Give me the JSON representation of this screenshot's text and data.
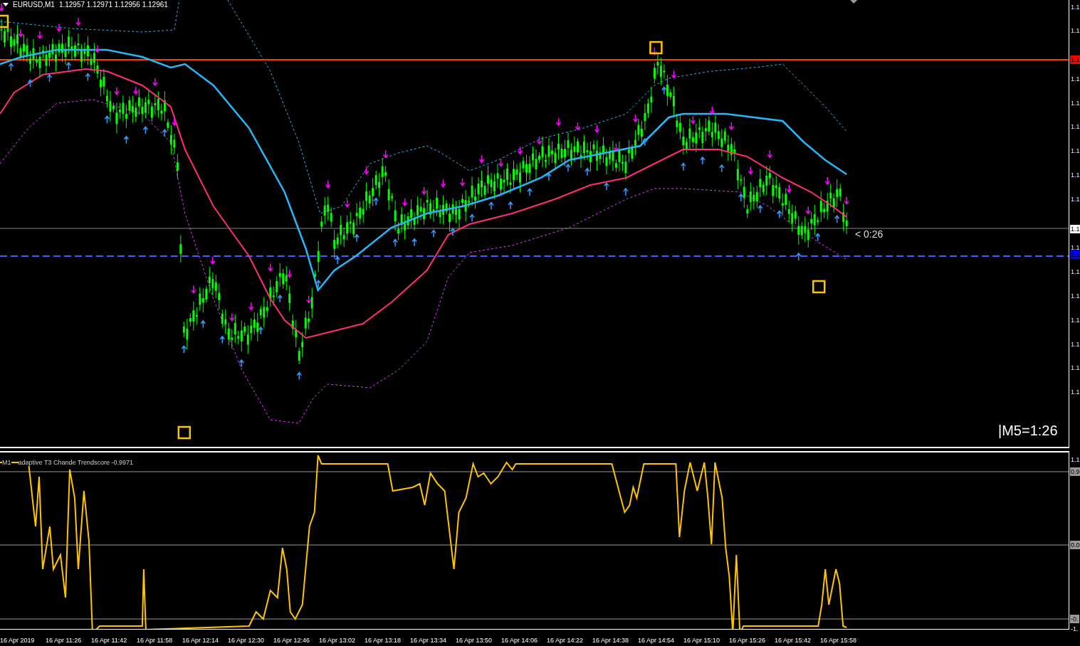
{
  "chart": {
    "symbol": "EURUSD,M1",
    "quotes": "1.12957 1.12971 1.12956 1.12961",
    "countdown": "< 0:26",
    "timeframe_timer": "|M5=1:26"
  },
  "price_axis": [
    {
      "label": "1.1",
      "kind": "plain"
    },
    {
      "label": "1.1",
      "kind": "plain"
    },
    {
      "label": "1.1",
      "kind": "red"
    },
    {
      "label": "1.1",
      "kind": "plain"
    },
    {
      "label": "1.1",
      "kind": "plain"
    },
    {
      "label": "1.1",
      "kind": "plain"
    },
    {
      "label": "1.1",
      "kind": "plain"
    },
    {
      "label": "1.1",
      "kind": "plain"
    },
    {
      "label": "1.1",
      "kind": "plain"
    },
    {
      "label": "1.1",
      "kind": "white"
    },
    {
      "label": "1.1",
      "kind": "plain"
    },
    {
      "label": "1.1",
      "kind": "blue"
    },
    {
      "label": "1.1",
      "kind": "plain"
    },
    {
      "label": "1.1",
      "kind": "plain"
    },
    {
      "label": "1.1",
      "kind": "plain"
    },
    {
      "label": "1.1",
      "kind": "plain"
    },
    {
      "label": "1.1",
      "kind": "plain"
    },
    {
      "label": "1.1",
      "kind": "plain"
    }
  ],
  "indicator": {
    "timeframe": "M1",
    "title": "adaptive T3 Chande Trendscore -0.9971"
  },
  "indicator_axis": [
    {
      "label": "1.1",
      "kind": "plain"
    },
    {
      "label": "0.9",
      "kind": "level"
    },
    {
      "label": "0.0",
      "kind": "level"
    },
    {
      "label": "-0.",
      "kind": "level"
    },
    {
      "label": "-1.",
      "kind": "plain"
    }
  ],
  "time_axis": [
    "16 Apr 2019",
    "16 Apr 11:26",
    "16 Apr 11:42",
    "16 Apr 11:58",
    "16 Apr 12:14",
    "16 Apr 12:30",
    "16 Apr 12:46",
    "16 Apr 13:02",
    "16 Apr 13:18",
    "16 Apr 13:34",
    "16 Apr 13:50",
    "16 Apr 14:06",
    "16 Apr 14:22",
    "16 Apr 14:38",
    "16 Apr 14:54",
    "16 Apr 15:10",
    "16 Apr 15:26",
    "16 Apr 15:42",
    "16 Apr 15:58"
  ]
}
